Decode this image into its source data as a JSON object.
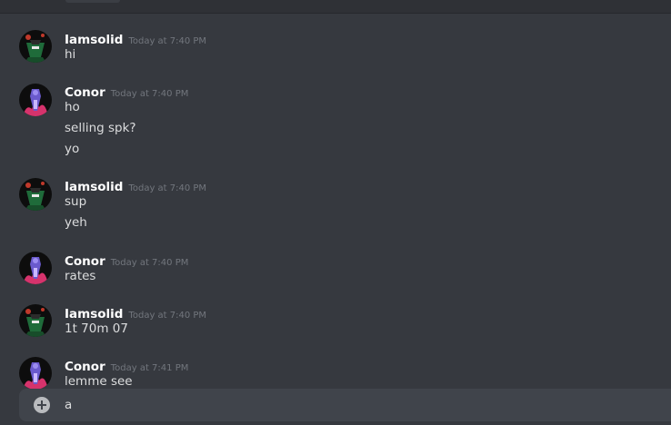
{
  "messages": [
    {
      "author": "Iamsolid",
      "timestamp": "Today at 7:40 PM",
      "avatar": "iamsolid-avatar",
      "lines": [
        "hi"
      ]
    },
    {
      "author": "Conor",
      "timestamp": "Today at 7:40 PM",
      "avatar": "conor-avatar",
      "lines": [
        "ho",
        "selling spk?",
        "yo"
      ]
    },
    {
      "author": "Iamsolid",
      "timestamp": "Today at 7:40 PM",
      "avatar": "iamsolid-avatar",
      "lines": [
        "sup",
        "yeh"
      ]
    },
    {
      "author": "Conor",
      "timestamp": "Today at 7:40 PM",
      "avatar": "conor-avatar",
      "lines": [
        "rates"
      ]
    },
    {
      "author": "Iamsolid",
      "timestamp": "Today at 7:40 PM",
      "avatar": "iamsolid-avatar",
      "lines": [
        "1t 70m 07"
      ]
    },
    {
      "author": "Conor",
      "timestamp": "Today at 7:41 PM",
      "avatar": "conor-avatar",
      "lines": [
        "lemme see"
      ]
    }
  ],
  "composer": {
    "value": "a",
    "add_icon": "plus-circle-icon"
  },
  "colors": {
    "background": "#36393f",
    "composer": "#40444b",
    "username": "#ffffff",
    "text": "#dcddde",
    "timestamp": "#72767d"
  }
}
